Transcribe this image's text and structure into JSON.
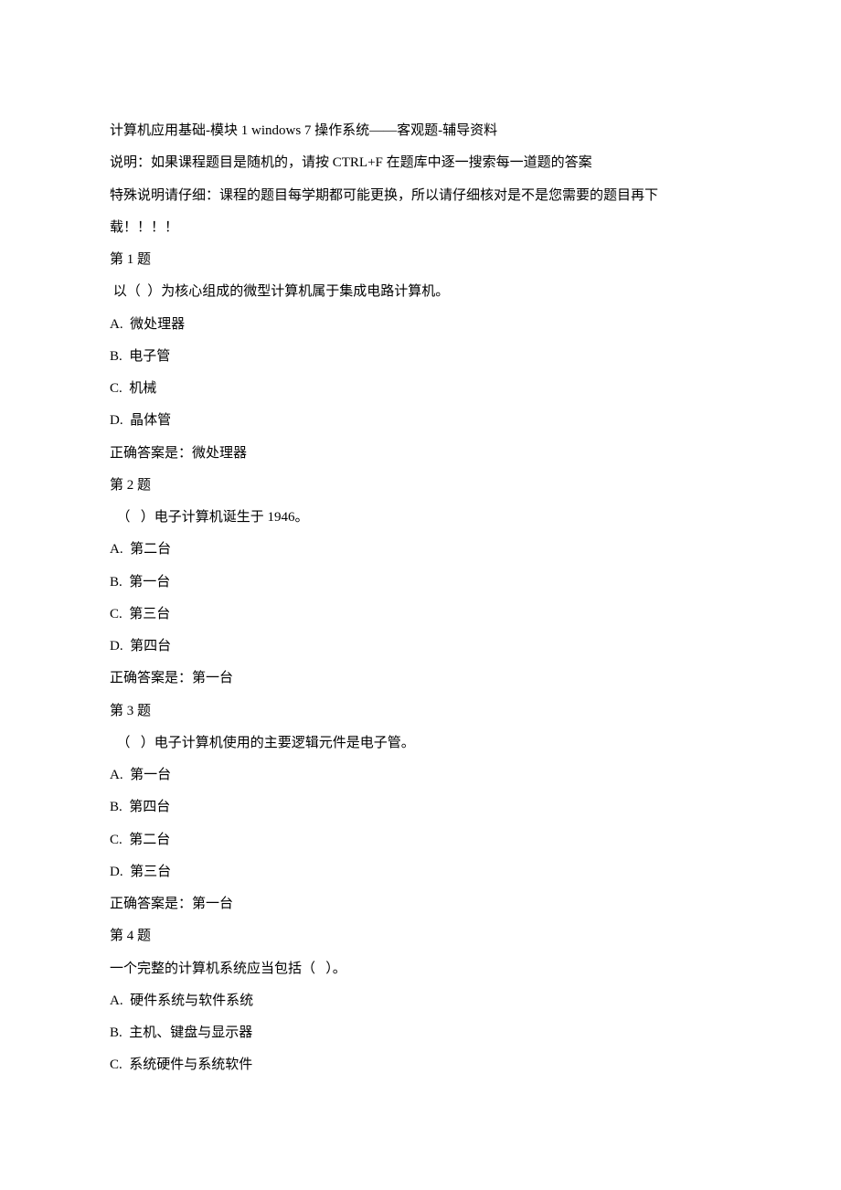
{
  "header": {
    "title": "计算机应用基础-模块 1 windows 7 操作系统——客观题-辅导资料",
    "note1": "说明：如果课程题目是随机的，请按 CTRL+F 在题库中逐一搜索每一道题的答案",
    "note2a": "特殊说明请仔细：课程的题目每学期都可能更换，所以请仔细核对是不是您需要的题目再下",
    "note2b": "载！！！！"
  },
  "q1": {
    "label": "第 1 题",
    "stem": " 以（  ）为核心组成的微型计算机属于集成电路计算机。",
    "a": "A.  微处理器",
    "b": "B.  电子管",
    "c": "C.  机械",
    "d": "D.  晶体管",
    "ans": "正确答案是：微处理器"
  },
  "q2": {
    "label": "第 2 题",
    "stem": "（   ）电子计算机诞生于 1946。",
    "a": "A.  第二台",
    "b": "B.  第一台",
    "c": "C.  第三台",
    "d": "D.  第四台",
    "ans": "正确答案是：第一台"
  },
  "q3": {
    "label": "第 3 题",
    "stem": "（   ）电子计算机使用的主要逻辑元件是电子管。",
    "a": "A.  第一台",
    "b": "B.  第四台",
    "c": "C.  第二台",
    "d": "D.  第三台",
    "ans": "正确答案是：第一台"
  },
  "q4": {
    "label": "第 4 题",
    "stem": "一个完整的计算机系统应当包括（   ）。",
    "a": "A.  硬件系统与软件系统",
    "b": "B.  主机、键盘与显示器",
    "c": "C.  系统硬件与系统软件"
  }
}
